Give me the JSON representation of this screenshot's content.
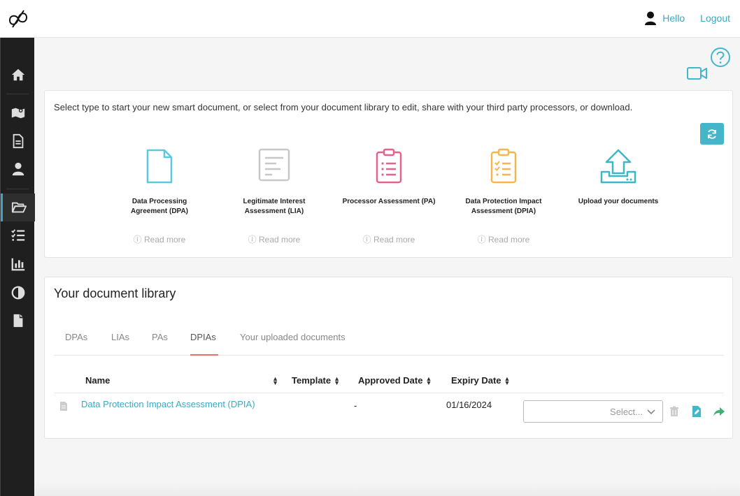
{
  "header": {
    "logo_icon": "infinity-logo-icon",
    "user_icon": "user-icon",
    "hello_label": "Hello",
    "logout_label": "Logout"
  },
  "sidebar": {
    "items": [
      {
        "icon": "home-icon"
      },
      {
        "icon": "map-icon"
      },
      {
        "icon": "document-icon"
      },
      {
        "icon": "user-icon"
      },
      {
        "icon": "folder-open-icon",
        "active": true
      },
      {
        "icon": "checklist-icon"
      },
      {
        "icon": "bar-chart-icon"
      },
      {
        "icon": "contrast-icon"
      },
      {
        "icon": "file-icon"
      }
    ]
  },
  "toolbar": {
    "help_icon": "question-circle-icon",
    "video_icon": "video-camera-icon"
  },
  "new_document": {
    "intro": "Select type to start your new smart document, or select from your document library to edit, share with your third party processors, or download.",
    "refresh_icon": "refresh-icon",
    "types": [
      {
        "label_line1": "Data Processing",
        "label_line2": "Agreement (DPA)",
        "read_more": "ⓘ Read more",
        "color": "#5bc8dd"
      },
      {
        "label_line1": "Legitimate Interest",
        "label_line2": "Assessment (LIA)",
        "read_more": "ⓘ Read more",
        "color": "#c8c8c8"
      },
      {
        "label_line1": "Processor Assessment (PA)",
        "label_line2": "",
        "read_more": "ⓘ Read more",
        "color": "#e5628a"
      },
      {
        "label_line1": "Data Protection Impact",
        "label_line2": "Assessment (DPIA)",
        "read_more": "ⓘ Read more",
        "color": "#f3b74c"
      },
      {
        "label_line1": "Upload your documents",
        "label_line2": "",
        "read_more": "",
        "color": "#3fb6c5"
      }
    ]
  },
  "library": {
    "title": "Your document library",
    "tabs": [
      {
        "label": "DPAs"
      },
      {
        "label": "LIAs"
      },
      {
        "label": "PAs"
      },
      {
        "label": "DPIAs",
        "active": true
      },
      {
        "label": "Your uploaded documents"
      }
    ],
    "columns": {
      "name": "Name",
      "template": "Template",
      "approved": "Approved Date",
      "expiry": "Expiry Date"
    },
    "rows": [
      {
        "name": "Data Protection Impact Assessment (DPIA)",
        "template": "-",
        "approved": "",
        "expiry": "01/16/2024",
        "select_placeholder": "Select...",
        "icons": [
          "trash-icon",
          "edit-document-icon",
          "share-icon"
        ]
      }
    ]
  }
}
